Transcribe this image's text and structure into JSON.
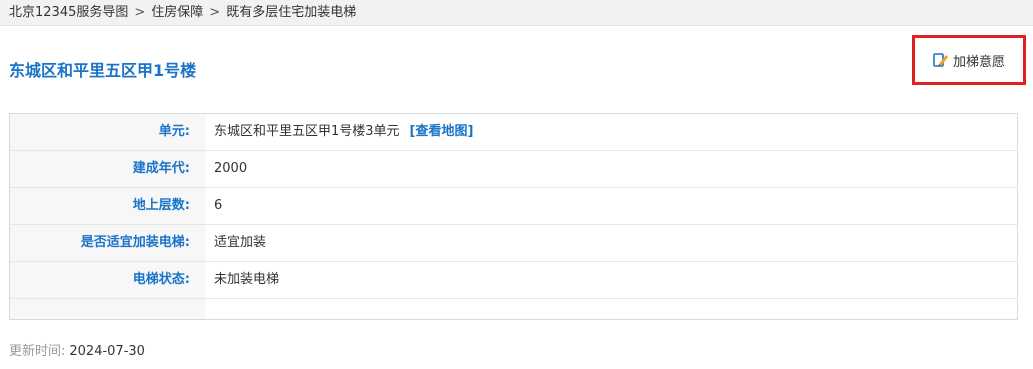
{
  "breadcrumb": {
    "items": [
      "北京12345服务导图",
      "住房保障",
      "既有多层住宅加装电梯"
    ],
    "separator": ">"
  },
  "page_title": "东城区和平里五区甲1号楼",
  "apply_button": {
    "label": "加梯意愿",
    "icon": "edit-pen-icon"
  },
  "info": {
    "rows": [
      {
        "label": "单元:",
        "value": "东城区和平里五区甲1号楼3单元",
        "link": "[查看地图]"
      },
      {
        "label": "建成年代:",
        "value": "2000"
      },
      {
        "label": "地上层数:",
        "value": "6"
      },
      {
        "label": "是否适宜加装电梯:",
        "value": "适宜加装"
      },
      {
        "label": "电梯状态:",
        "value": "未加装电梯"
      }
    ]
  },
  "updated": {
    "label": "更新时间:",
    "value": "2024-07-30"
  },
  "colors": {
    "accent": "#1a74c8",
    "highlight_box": "#e02020",
    "muted": "#999999"
  }
}
